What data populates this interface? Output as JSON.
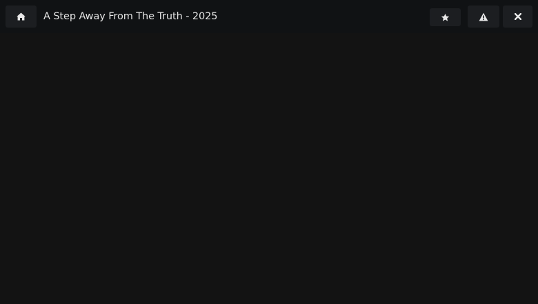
{
  "header": {
    "title": "A Step Away From The Truth - 2025",
    "buttons": [
      {
        "name": "home",
        "icon": "home-icon"
      },
      {
        "name": "favorite",
        "icon": "star-icon"
      },
      {
        "name": "report",
        "icon": "warning-icon"
      },
      {
        "name": "close",
        "icon": "close-icon"
      }
    ]
  },
  "colors": {
    "background": "#131313",
    "header_background": "#101214",
    "button_background": "#1c1e21",
    "icon": "#e8e8e8",
    "text": "#e4e4e4"
  }
}
